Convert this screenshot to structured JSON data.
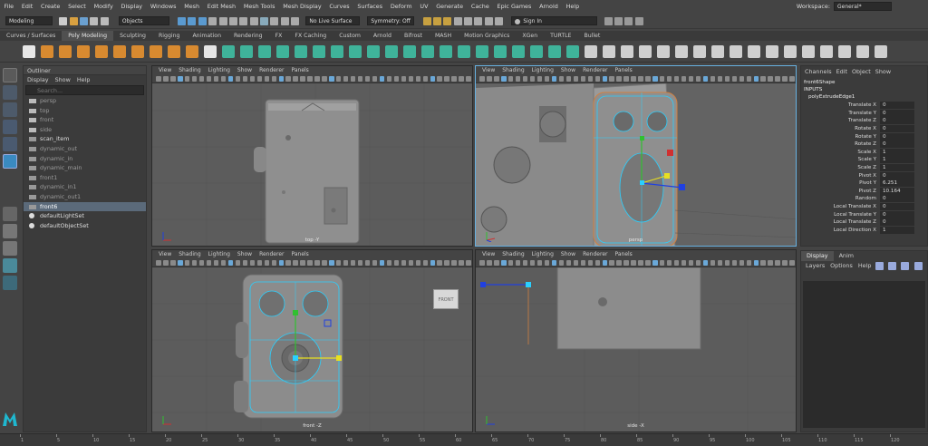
{
  "menu": {
    "items": [
      "File",
      "Edit",
      "Create",
      "Select",
      "Modify",
      "Display",
      "Windows",
      "Mesh",
      "Edit Mesh",
      "Mesh Tools",
      "Mesh Display",
      "Curves",
      "Surfaces",
      "Deform",
      "UV",
      "Generate",
      "Cache",
      "Epic Games",
      "Arnold",
      "Help"
    ],
    "workspace_label": "Workspace:",
    "workspace_value": "General*"
  },
  "status": {
    "mode": "Modeling",
    "objects": "Objects",
    "live_surface": "No Live Surface",
    "symmetry": "Symmetry: Off",
    "sign_in": "Sign In"
  },
  "shelf_tabs": [
    "Curves / Surfaces",
    "Poly Modeling",
    "Sculpting",
    "Rigging",
    "Animation",
    "Rendering",
    "FX",
    "FX Caching",
    "Custom",
    "Arnold",
    "Bifrost",
    "MASH",
    "Motion Graphics",
    "XGen",
    "TURTLE",
    "Bullet"
  ],
  "active_shelf_tab": "Poly Modeling",
  "outliner": {
    "title": "Outliner",
    "menu": [
      "Display",
      "Show",
      "Help"
    ],
    "search_placeholder": "Search...",
    "items": [
      {
        "label": "persp",
        "icon": "camera",
        "visible": false,
        "selected": false
      },
      {
        "label": "top",
        "icon": "camera",
        "visible": false,
        "selected": false
      },
      {
        "label": "front",
        "icon": "camera",
        "visible": false,
        "selected": false
      },
      {
        "label": "side",
        "icon": "camera",
        "visible": false,
        "selected": false
      },
      {
        "label": "scan_item",
        "icon": "mesh",
        "visible": true,
        "selected": false
      },
      {
        "label": "dynamic_out",
        "icon": "mesh",
        "visible": false,
        "selected": false
      },
      {
        "label": "dynamic_in",
        "icon": "mesh",
        "visible": false,
        "selected": false
      },
      {
        "label": "dynamic_main",
        "icon": "mesh",
        "visible": false,
        "selected": false
      },
      {
        "label": "front1",
        "icon": "mesh",
        "visible": false,
        "selected": false
      },
      {
        "label": "dynamic_in1",
        "icon": "mesh",
        "visible": false,
        "selected": false
      },
      {
        "label": "dynamic_out1",
        "icon": "mesh",
        "visible": false,
        "selected": false
      },
      {
        "label": "front6",
        "icon": "mesh",
        "visible": true,
        "selected": true
      },
      {
        "label": "defaultLightSet",
        "icon": "set",
        "visible": true,
        "selected": false
      },
      {
        "label": "defaultObjectSet",
        "icon": "set",
        "visible": true,
        "selected": false
      }
    ]
  },
  "viewport_menu": [
    "View",
    "Shading",
    "Lighting",
    "Show",
    "Renderer",
    "Panels"
  ],
  "viewports": {
    "top": {
      "camera": "top -Y"
    },
    "persp": {
      "camera": "persp"
    },
    "front": {
      "camera": "front -Z",
      "view_cube": "FRONT"
    },
    "side": {
      "camera": "side -X"
    }
  },
  "channel_box": {
    "tabs": [
      "Channels",
      "Edit",
      "Object",
      "Show"
    ],
    "shape": "front6Shape",
    "inputs": "INPUTS",
    "node": "polyExtrudeEdge1",
    "attrs": [
      {
        "label": "Translate X",
        "value": "0"
      },
      {
        "label": "Translate Y",
        "value": "0"
      },
      {
        "label": "Translate Z",
        "value": "0"
      },
      {
        "label": "Rotate X",
        "value": "0"
      },
      {
        "label": "Rotate Y",
        "value": "0"
      },
      {
        "label": "Rotate Z",
        "value": "0"
      },
      {
        "label": "Scale X",
        "value": "1"
      },
      {
        "label": "Scale Y",
        "value": "1"
      },
      {
        "label": "Scale Z",
        "value": "1"
      },
      {
        "label": "Pivot X",
        "value": "0"
      },
      {
        "label": "Pivot Y",
        "value": "6.251"
      },
      {
        "label": "Pivot Z",
        "value": "10.164"
      },
      {
        "label": "Random",
        "value": "0"
      },
      {
        "label": "Local Translate X",
        "value": "0"
      },
      {
        "label": "Local Translate Y",
        "value": "0"
      },
      {
        "label": "Local Translate Z",
        "value": "0"
      },
      {
        "label": "Local Direction X",
        "value": "1"
      }
    ]
  },
  "layers": {
    "tabs": [
      "Display",
      "Anim"
    ],
    "active_tab": "Display",
    "menu": [
      "Layers",
      "Options",
      "Help"
    ]
  },
  "timeslider": {
    "ticks": [
      "1",
      "5",
      "10",
      "15",
      "20",
      "25",
      "30",
      "35",
      "40",
      "45",
      "50",
      "55",
      "60",
      "65",
      "70",
      "75",
      "80",
      "85",
      "90",
      "95",
      "100",
      "105",
      "110",
      "115",
      "120"
    ]
  },
  "colors": {
    "accent_blue": "#5b6a7a",
    "manipulator_red": "#d03030",
    "manipulator_green": "#30c030",
    "manipulator_blue": "#2040e0",
    "manipulator_yellow": "#e8e020",
    "selection_cyan": "#2ad0ff",
    "maya_logo": "#1fb8d0"
  }
}
